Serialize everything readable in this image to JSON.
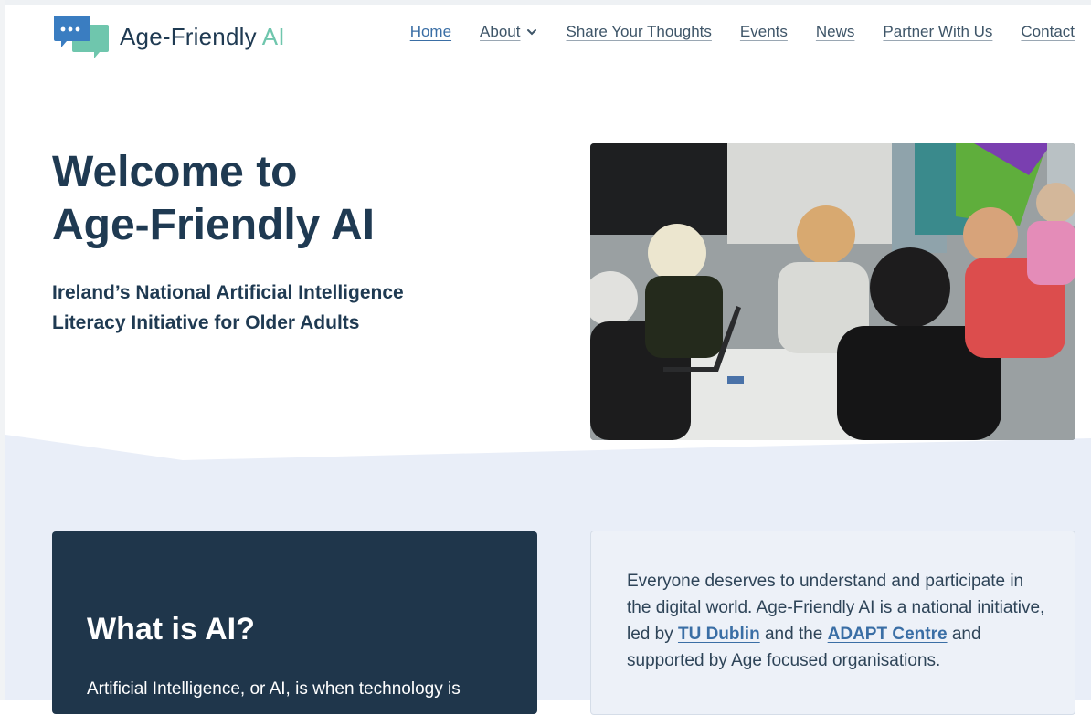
{
  "brand": {
    "name_main": "Age-Friendly ",
    "name_accent": "AI",
    "logo_icon": "chat-bubbles-icon",
    "colors": {
      "navy": "#1f3a52",
      "accent_green": "#6fc6ad",
      "bubble_blue": "#3a7dc1",
      "link_blue": "#3a6ea5"
    }
  },
  "nav": {
    "items": [
      {
        "label": "Home",
        "active": true
      },
      {
        "label": "About",
        "has_dropdown": true
      },
      {
        "label": "Share Your Thoughts"
      },
      {
        "label": "Events"
      },
      {
        "label": "News"
      },
      {
        "label": "Partner With Us"
      },
      {
        "label": "Contact"
      }
    ]
  },
  "hero": {
    "title_line1": "Welcome to",
    "title_line2": "Age-Friendly AI",
    "subtitle_line1": "Ireland’s National Artificial Intelligence",
    "subtitle_line2": "Literacy Initiative for Older Adults",
    "photo": "group-workshop-photo"
  },
  "what_is_ai": {
    "heading": "What is AI?",
    "text": "Artificial Intelligence, or AI, is when technology is"
  },
  "intro": {
    "text_1": "Everyone deserves to understand and participate in the digital world. Age-Friendly AI is a national initiative, led by ",
    "link_1": "TU Dublin",
    "text_2": " and the ",
    "link_2": "ADAPT Centre",
    "text_3": " and supported by Age focused organisations."
  }
}
